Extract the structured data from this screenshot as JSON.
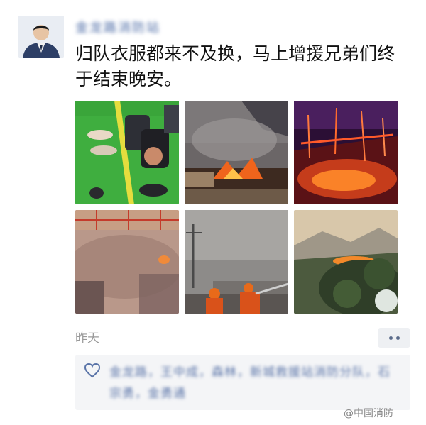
{
  "post": {
    "username": "金龙路消防站",
    "text": "归队衣服都来不及换，马上增援兄弟们终于结束晚安。",
    "timestamp": "昨天",
    "photos": [
      {
        "name": "firefighter-gear-on-floor"
      },
      {
        "name": "burning-building"
      },
      {
        "name": "night-forest-fire"
      },
      {
        "name": "smoky-hangar"
      },
      {
        "name": "firefighters-hosing"
      },
      {
        "name": "hillside-forest-fire"
      }
    ]
  },
  "likes": {
    "names": "金龙路，王中成，森林，新城救援站消防分队，石宗勇，金勇通"
  },
  "watermark": "@中国消防",
  "icons": {
    "heart": "heart-icon",
    "more": "more-dots-icon"
  }
}
